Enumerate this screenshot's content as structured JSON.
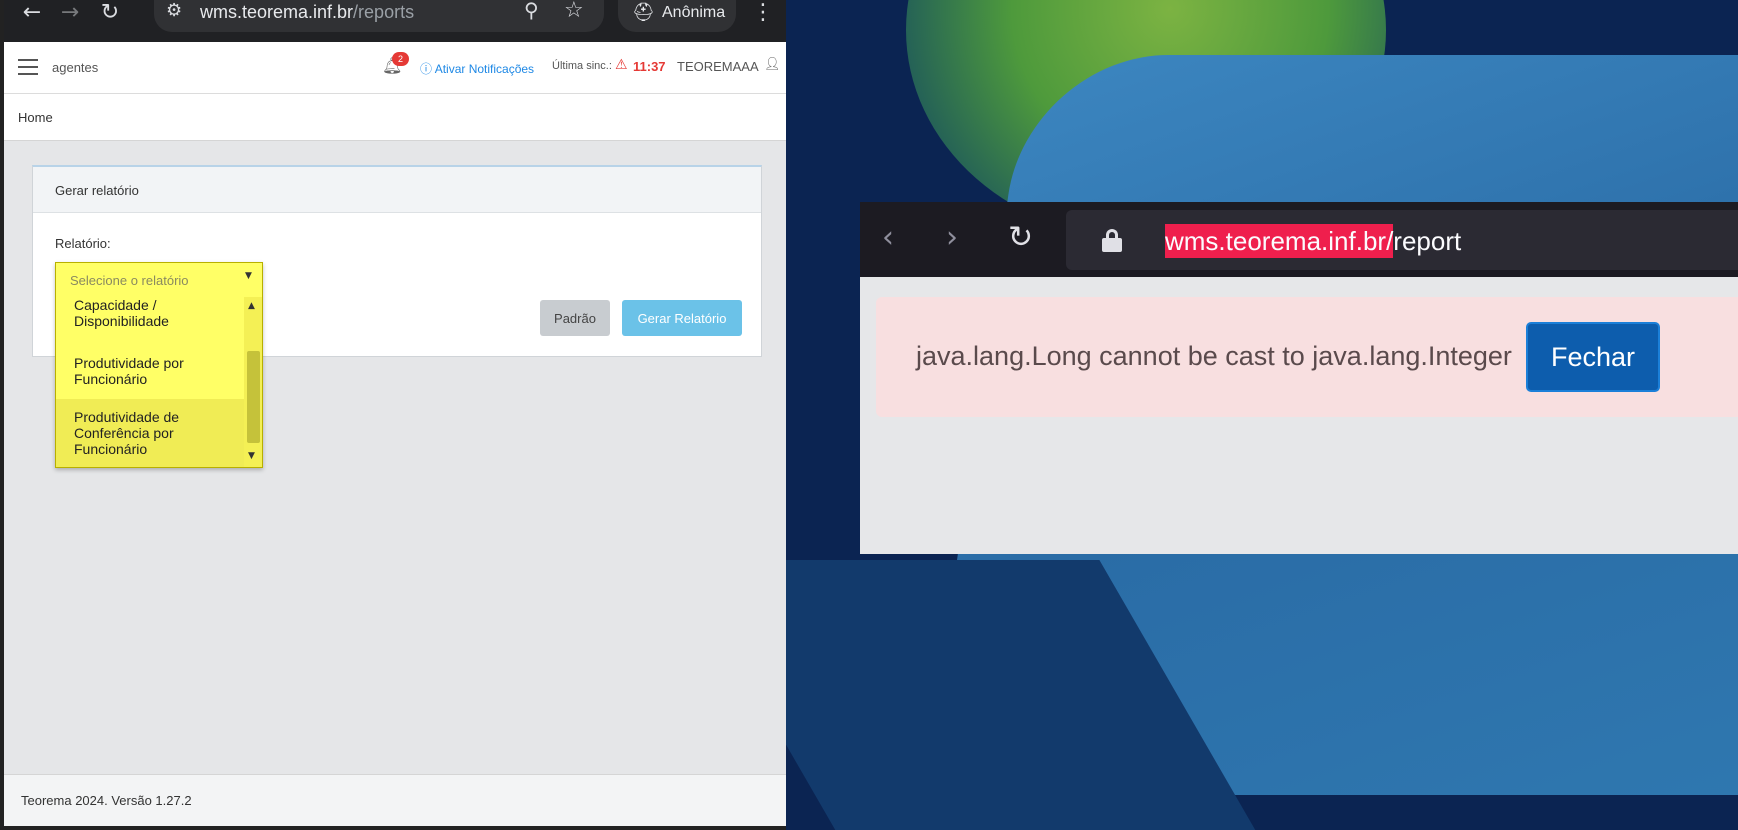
{
  "left_browser": {
    "url_host": "wms.teorema.inf.br",
    "url_path": "/reports",
    "incognito_label": "Anônima",
    "icons": [
      "back-icon",
      "forward-icon",
      "reload-icon",
      "site-settings-icon",
      "zoom-icon",
      "star-icon",
      "incognito-icon",
      "menu-icon"
    ]
  },
  "header": {
    "app_name": "agentes",
    "notification_count": "2",
    "notifications_link": "Ativar Notificações",
    "sync_label": "Última sinc.:",
    "sync_time": "11:37",
    "user": "TEOREMAAA"
  },
  "breadcrumb": "Home",
  "report_form": {
    "title": "Gerar relatório",
    "field_label": "Relatório:",
    "select_placeholder": "Selecione o relatório",
    "options": [
      "Capacidade / Disponibilidade",
      "Produtividade por Funcionário",
      "Produtividade de Conferência por Funcionário"
    ],
    "default_button": "Padrão",
    "generate_button": "Gerar Relatório"
  },
  "footer": "Teorema 2024. Versão 1.27.2",
  "right_browser": {
    "url_highlighted": "wms.teorema.inf.br/",
    "url_rest": "report",
    "error_message": "java.lang.Long cannot be cast to java.lang.Integer",
    "close_button": "Fechar"
  },
  "colors": {
    "highlight_yellow": "#ffff66",
    "url_highlight_red": "#ef1f4d",
    "alert_bg": "#f8dfe0",
    "button_blue": "#0d5dad",
    "sync_red": "#e53935"
  }
}
